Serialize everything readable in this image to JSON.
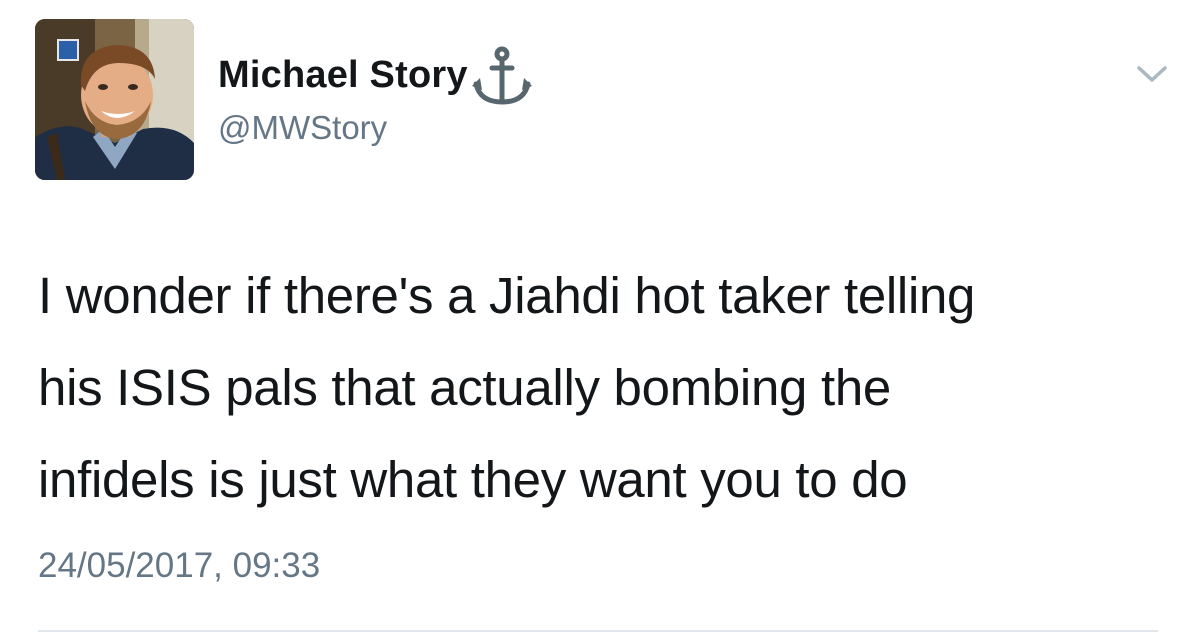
{
  "tweet": {
    "author": {
      "display_name": "Michael Story",
      "handle": "@MWStory",
      "avatar_icon": "profile-photo",
      "name_emoji_icon": "anchor-icon"
    },
    "menu_icon": "chevron-down-icon",
    "text_lines": [
      "I wonder if there's a Jiahdi hot taker telling",
      "his ISIS pals that actually bombing the",
      "infidels is just what they want you to do"
    ],
    "timestamp": "24/05/2017, 09:33"
  },
  "colors": {
    "text_primary": "#14171a",
    "text_secondary": "#657786",
    "divider": "#e1e8ed",
    "caret": "#aab8c2"
  }
}
